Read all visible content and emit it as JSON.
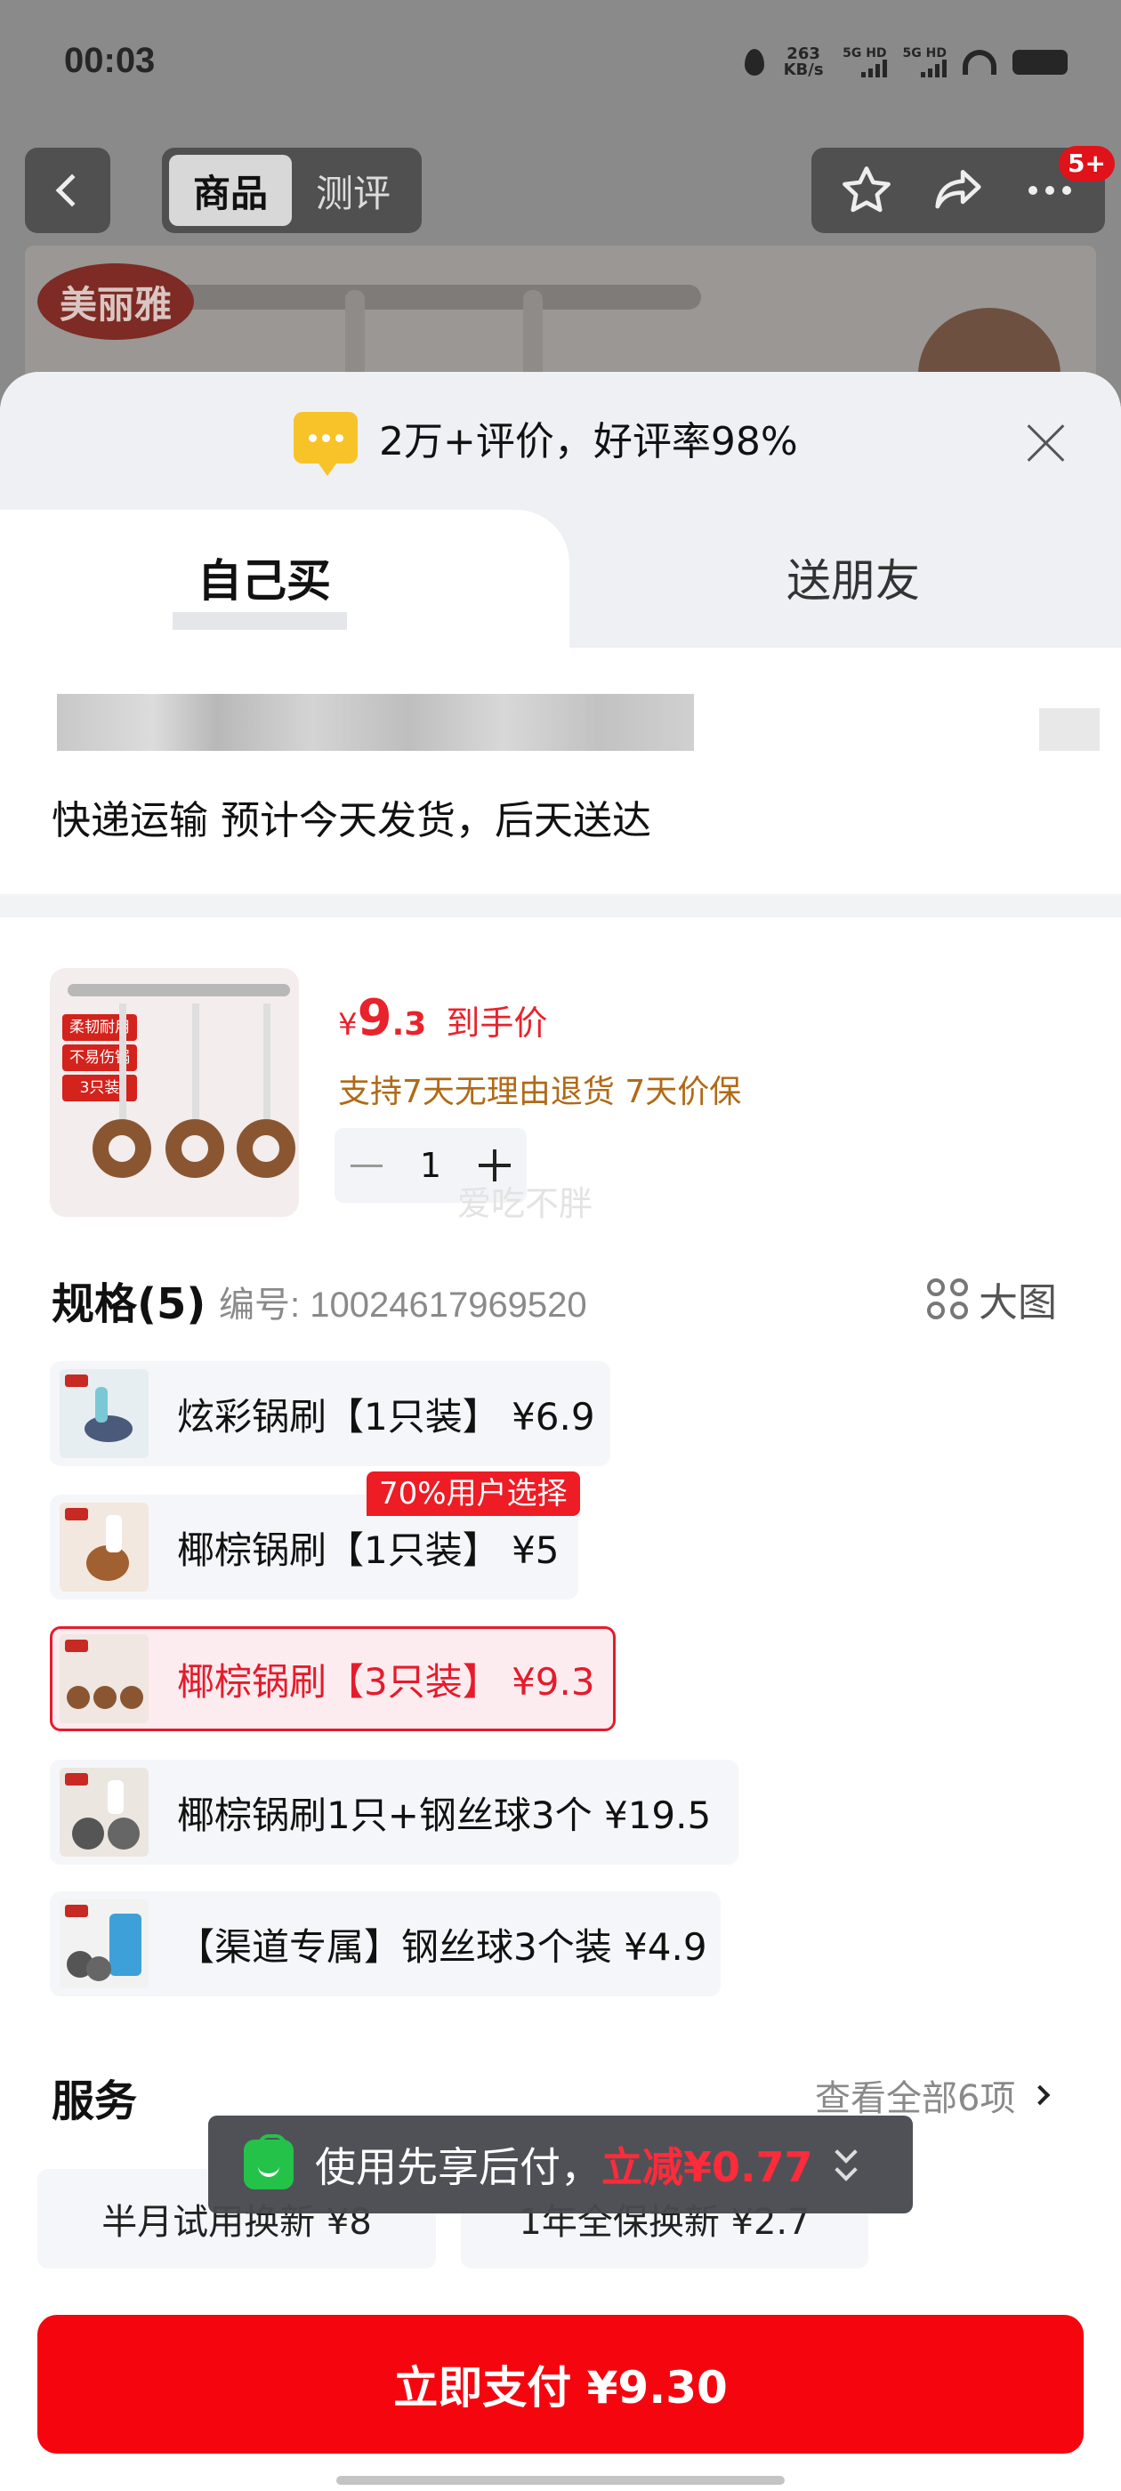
{
  "status_bar": {
    "time": "00:03",
    "net_speed_value": "263",
    "net_speed_unit": "KB/s",
    "sim1_label": "5G HD",
    "sim2_label": "5G HD"
  },
  "nav": {
    "tabs": [
      "商品",
      "测评"
    ],
    "active_tab": "商品",
    "badge": "5+",
    "icons": [
      "back-icon",
      "star-icon",
      "share-icon",
      "more-icon"
    ]
  },
  "background": {
    "brand_logo_text": "美丽雅"
  },
  "sheet": {
    "rating_text": "2万+评价，好评率98%",
    "tabs": [
      {
        "label": "自己买",
        "active": true
      },
      {
        "label": "送朋友",
        "active": false
      }
    ],
    "delivery_text": "快递运输 预计今天发货，后天送达"
  },
  "product": {
    "image_tags": [
      "柔韧耐用",
      "不易伤锅",
      "3只装"
    ],
    "price_symbol": "¥",
    "price_int": "9",
    "price_dec": ".3",
    "price_label": "到手价",
    "service_text": "支持7天无理由退货  7天价保",
    "quantity": "1",
    "watermark": "爱吃不胖"
  },
  "spec": {
    "title": "规格(5)",
    "code_label": "编号: 10024617969520",
    "big_view_label": "大图",
    "popular_badge": "70%用户选择",
    "options": [
      {
        "label": "炫彩锅刷【1只装】 ¥6.9",
        "selected": false
      },
      {
        "label": "椰棕锅刷【1只装】 ¥5",
        "selected": false
      },
      {
        "label": "椰棕锅刷【3只装】 ¥9.3",
        "selected": true
      },
      {
        "label": "椰棕锅刷1只+钢丝球3个  ¥19.5",
        "selected": false
      },
      {
        "label": "【渠道专属】钢丝球3个装  ¥4.9",
        "selected": false
      }
    ]
  },
  "services": {
    "title": "服务",
    "more_label": "查看全部6项",
    "items": [
      "半月试用换新 ¥8",
      "1年全保换新 ¥2.7"
    ]
  },
  "toast": {
    "text": "使用先享后付，",
    "highlight": "立减¥0.77"
  },
  "pay_button": "立即支付 ¥9.30",
  "colors": {
    "accent_red": "#f5060f",
    "price_red": "#e8232c",
    "service_orange": "#b06a16",
    "toast_green": "#25c24a"
  }
}
